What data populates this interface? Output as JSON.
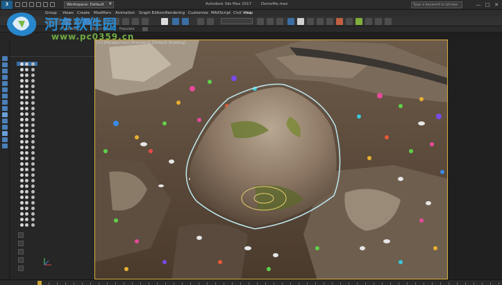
{
  "titlebar": {
    "app_badge": "3",
    "workspace": "Workspace: Default",
    "app_title": "Autodesk 3ds Max 2017",
    "file_title": "Demofile.max",
    "search_placeholder": "Type a keyword or phrase",
    "controls": [
      "—",
      "□",
      "✕"
    ]
  },
  "menubar": {
    "items": [
      "Group",
      "Views",
      "Create",
      "Modifiers",
      "Animation",
      "Graph Editors",
      "Rendering",
      "Customize",
      "MAXScript",
      "Civil View",
      "Help"
    ]
  },
  "ribbon": {
    "labels": [
      "Selection",
      "Object Paint",
      "Populate"
    ]
  },
  "viewport": {
    "label": "[+] [Perspective] [Standard] [Default Shading]"
  },
  "watermark": {
    "text": "河东软件园",
    "url": "www.pc0359.cn"
  },
  "colors": {
    "accent": "#4a7fb8",
    "viewport_border": "#d8b040",
    "selection_outline": "#bfe8f0",
    "watermark_blue": "#2896e6",
    "watermark_green": "#78b946"
  }
}
